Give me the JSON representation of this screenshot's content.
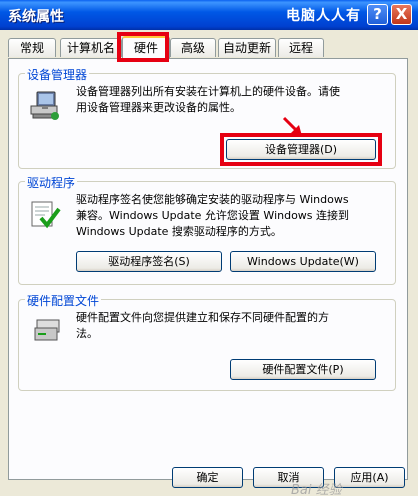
{
  "window": {
    "title": "系统属性",
    "watermark": "电脑人人有"
  },
  "titlebar_buttons": {
    "help": "?",
    "close": "X"
  },
  "tabs": [
    {
      "label": "常规"
    },
    {
      "label": "计算机名"
    },
    {
      "label": "硬件"
    },
    {
      "label": "高级"
    },
    {
      "label": "自动更新"
    },
    {
      "label": "远程"
    }
  ],
  "device_manager": {
    "title": "设备管理器",
    "desc_line1": "设备管理器列出所有安装在计算机上的硬件设备。请使",
    "desc_line2": "用设备管理器来更改设备的属性。",
    "button": "设备管理器(D)"
  },
  "drivers": {
    "title": "驱动程序",
    "desc_line1": "驱动程序签名使您能够确定安装的驱动程序与 Windows",
    "desc_line2": "兼容。Windows Update 允许您设置 Windows 连接到",
    "desc_line3": "Windows Update 搜索驱动程序的方式。",
    "signing_button": "驱动程序签名(S)",
    "update_button": "Windows Update(W)"
  },
  "hardware_profiles": {
    "title": "硬件配置文件",
    "desc_line1": "硬件配置文件向您提供建立和保存不同硬件配置的方",
    "desc_line2": "法。",
    "button": "硬件配置文件(P)"
  },
  "footer": {
    "ok": "确定",
    "cancel": "取消",
    "apply": "应用(A)"
  },
  "watermark_bottom": "Bai 经验"
}
